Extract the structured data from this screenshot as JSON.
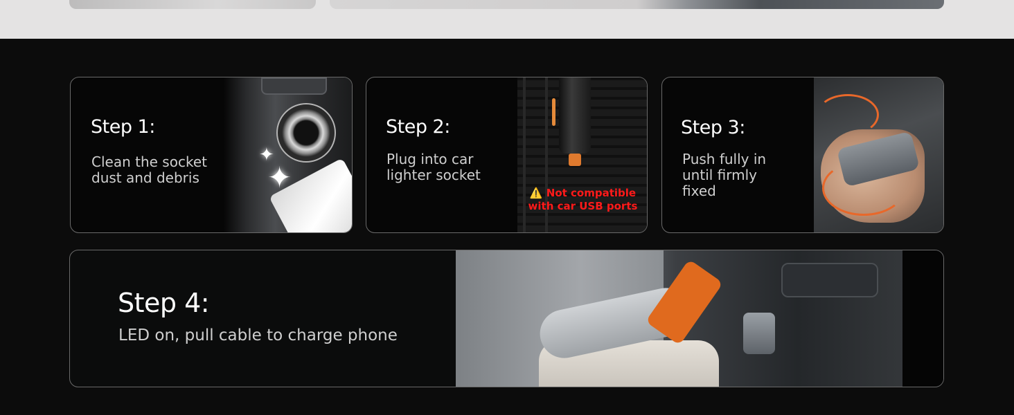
{
  "steps": [
    {
      "title": "Step 1:",
      "text_lines": [
        "Clean the socket",
        "dust and debris"
      ]
    },
    {
      "title": "Step 2:",
      "text_lines": [
        "Plug into car",
        "lighter socket"
      ],
      "warning_lines": [
        "⚠️ Not compatible",
        "with car USB ports"
      ]
    },
    {
      "title": "Step 3:",
      "text_lines": [
        "Push fully in",
        "until firmly",
        "fixed"
      ]
    },
    {
      "title": "Step 4:",
      "text": "LED on, pull cable to charge phone"
    }
  ],
  "colors": {
    "background": "#0c0c0c",
    "card_border": "#6a6a6a",
    "warning": "#ff1a1a",
    "accent": "#e8682a"
  }
}
